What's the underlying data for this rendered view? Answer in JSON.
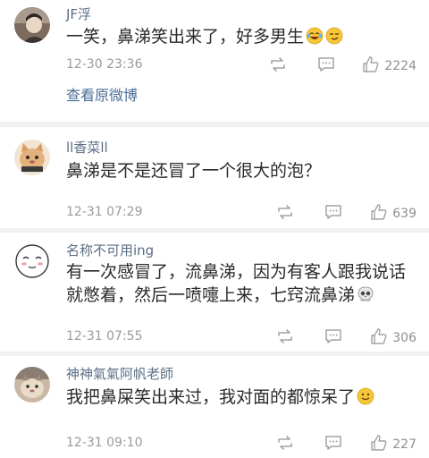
{
  "comments": [
    {
      "author": "JF浮",
      "text": "一笑，鼻涕笑出来了，好多男生",
      "time": "12-30 23:36",
      "likes": "2224",
      "view_original": "查看原微博",
      "emojis": [
        "laughing-tears-emoji",
        "smirk-emoji"
      ]
    },
    {
      "author": "ll香菜ll",
      "text": "鼻涕是不是还冒了一个很大的泡？",
      "time": "12-31 07:29",
      "likes": "639"
    },
    {
      "author": "名称不可用ing",
      "text": "有一次感冒了，流鼻涕，因为有客人跟我说话就憋着，然后一喷嚏上来，七窍流鼻涕",
      "time": "12-31 07:55",
      "likes": "306",
      "emojis": [
        "skull-emoji"
      ]
    },
    {
      "author": "神神氣氣阿帆老師",
      "text": "我把鼻屎笑出来过，我对面的都惊呆了",
      "time": "12-31 09:10",
      "likes": "227",
      "emojis": [
        "smile-emoji"
      ]
    }
  ],
  "icons": {
    "repost": "repost-icon",
    "reply": "reply-icon",
    "like": "thumbs-up-icon"
  },
  "colors": {
    "name": "#5d6f85",
    "text": "#2b2b2b",
    "meta": "#9b9b9b",
    "link": "#4a6e96",
    "separator": "#f1f1f1"
  }
}
